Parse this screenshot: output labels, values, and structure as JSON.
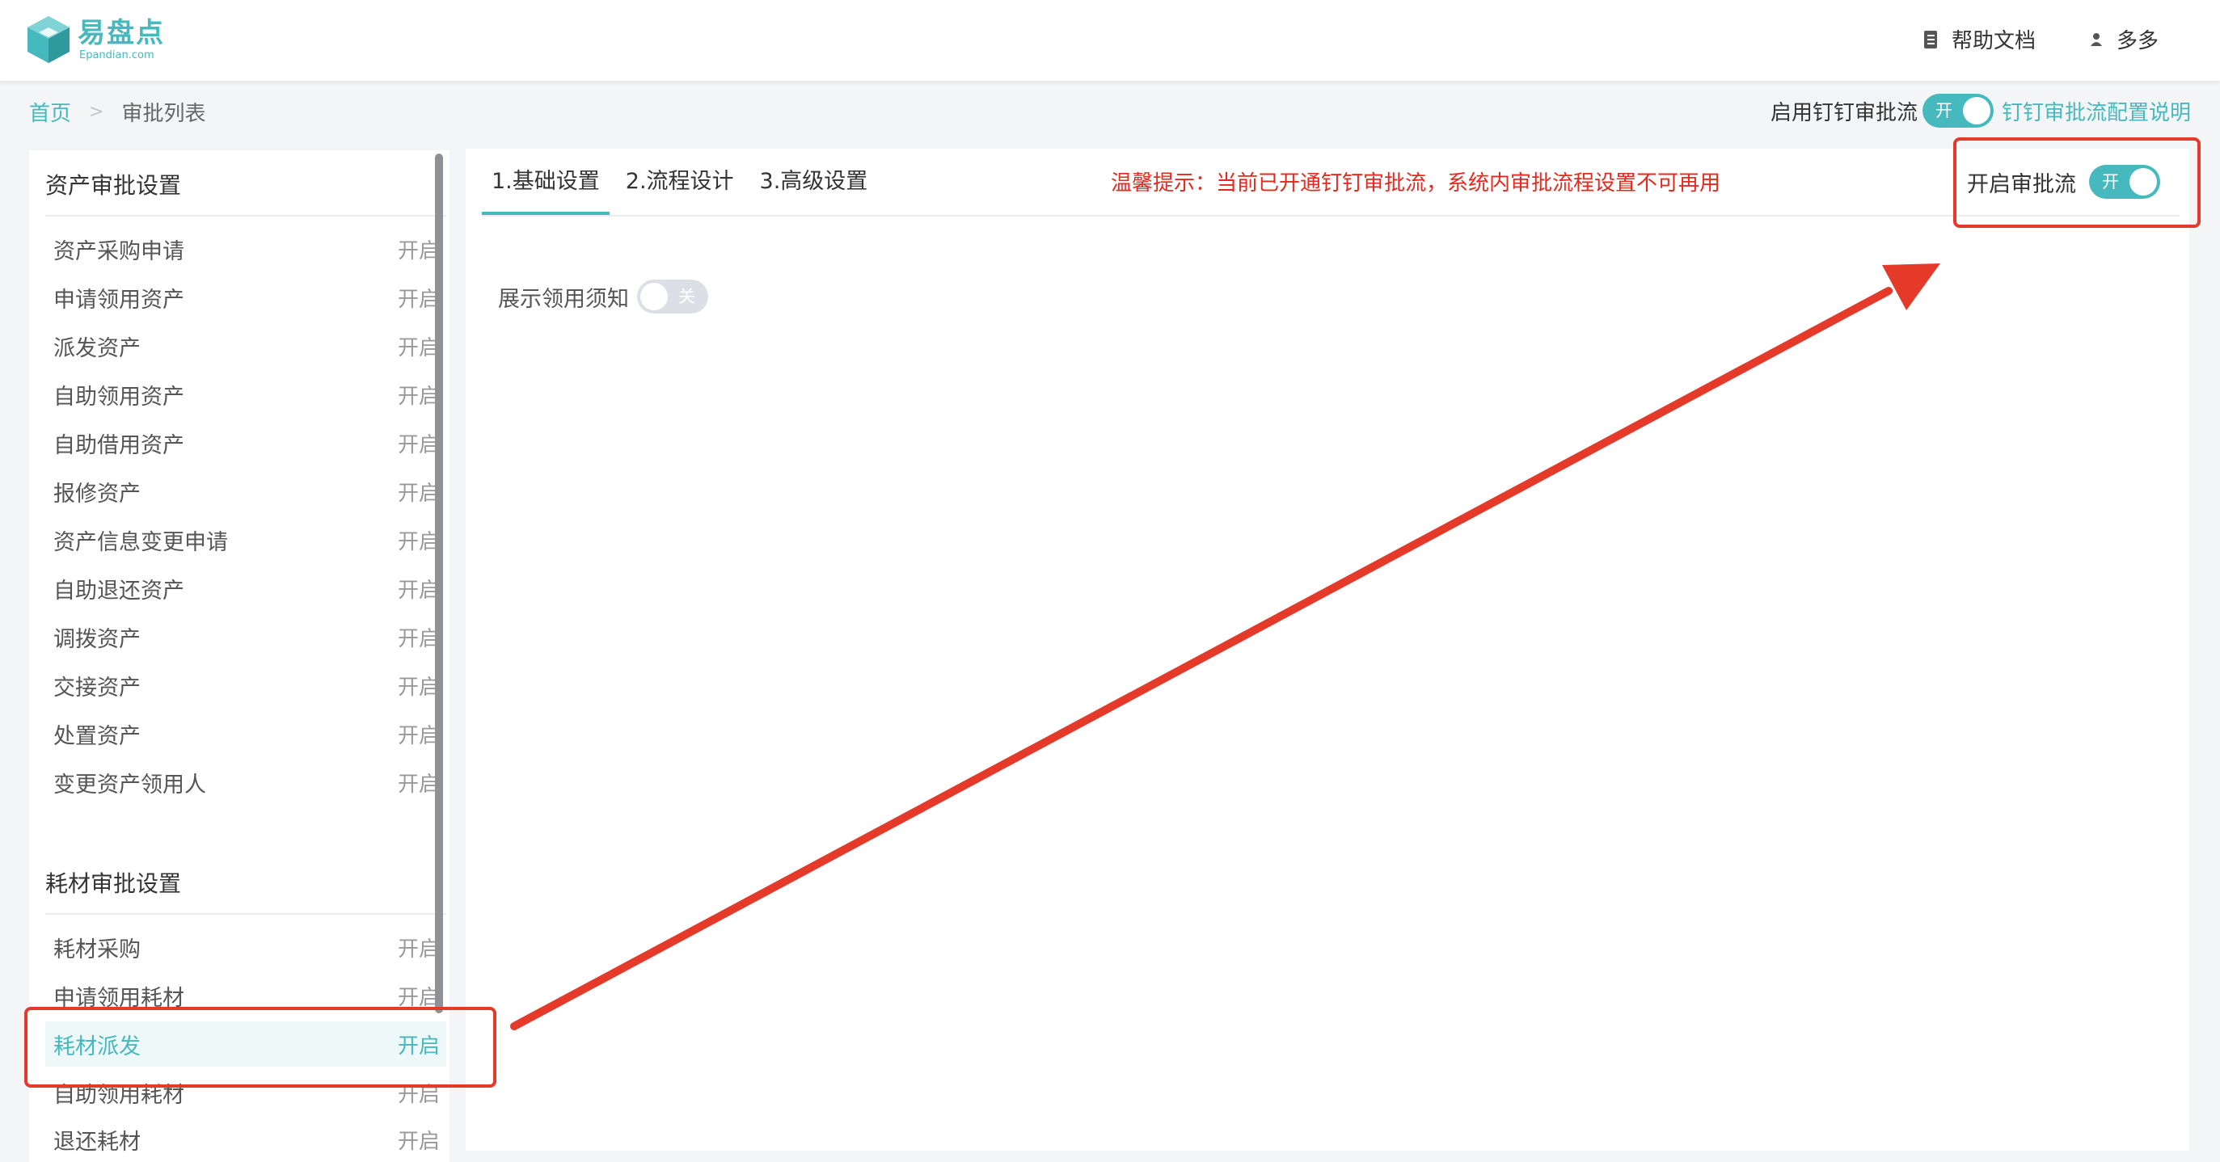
{
  "header": {
    "logo_cn": "易盘点",
    "logo_en": "Epandian.com",
    "help_label": "帮助文档",
    "user_name": "多多"
  },
  "breadcrumb": {
    "home": "首页",
    "separator": ">",
    "current": "审批列表"
  },
  "dingtalk": {
    "label": "启用钉钉审批流",
    "switch_text": "开",
    "switch_on": true,
    "link": "钉钉审批流配置说明"
  },
  "sidebar": {
    "asset_section": {
      "title": "资产审批设置",
      "items": [
        {
          "label": "资产采购申请",
          "status": "开启"
        },
        {
          "label": "申请领用资产",
          "status": "开启"
        },
        {
          "label": "派发资产",
          "status": "开启"
        },
        {
          "label": "自助领用资产",
          "status": "开启"
        },
        {
          "label": "自助借用资产",
          "status": "开启"
        },
        {
          "label": "报修资产",
          "status": "开启"
        },
        {
          "label": "资产信息变更申请",
          "status": "开启"
        },
        {
          "label": "自助退还资产",
          "status": "开启"
        },
        {
          "label": "调拨资产",
          "status": "开启"
        },
        {
          "label": "交接资产",
          "status": "开启"
        },
        {
          "label": "处置资产",
          "status": "开启"
        },
        {
          "label": "变更资产领用人",
          "status": "开启"
        }
      ]
    },
    "consumable_section": {
      "title": "耗材审批设置",
      "items": [
        {
          "label": "耗材采购",
          "status": "开启"
        },
        {
          "label": "申请领用耗材",
          "status": "开启"
        },
        {
          "label": "耗材派发",
          "status": "开启",
          "active": true
        },
        {
          "label": "自助领用耗材",
          "status": "开启"
        },
        {
          "label": "退还耗材",
          "status": "开启"
        }
      ]
    }
  },
  "main": {
    "tabs": [
      {
        "label": "1.基础设置",
        "active": true
      },
      {
        "label": "2.流程设计"
      },
      {
        "label": "3.高级设置"
      }
    ],
    "warning": "温馨提示：当前已开通钉钉审批流，系统内审批流程设置不可再用",
    "approve_flow": {
      "label": "开启审批流",
      "switch_text": "开",
      "on": true
    },
    "notice": {
      "label": "展示领用须知",
      "switch_text": "关",
      "on": false
    }
  },
  "colors": {
    "brand": "#45b9bd",
    "warning": "#e6281e",
    "annotation": "#e53a2a"
  }
}
